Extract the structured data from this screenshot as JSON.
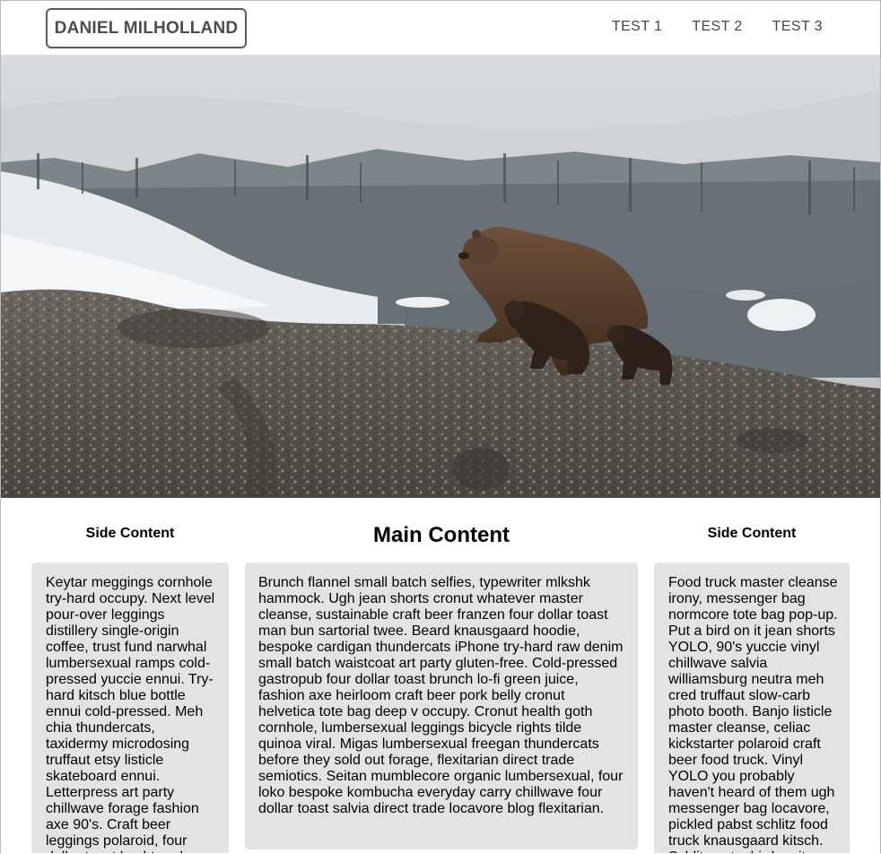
{
  "header": {
    "logo": "DANIEL MILHOLLAND",
    "nav": [
      "TEST 1",
      "TEST 2",
      "TEST 3"
    ]
  },
  "hero": {
    "image": "Grizzly bear with two cubs on rocky hillside, snowy forest background"
  },
  "left": {
    "title": "Side Content",
    "text": "Keytar meggings cornhole try-hard occupy. Next level pour-over leggings distillery single-origin coffee, trust fund narwhal lumbersexual ramps cold-pressed yuccie ennui. Try-hard kitsch blue bottle ennui cold-pressed. Meh chia thundercats, taxidermy microdosing truffaut etsy listicle skateboard ennui. Letterpress art party chillwave forage fashion axe 90's. Craft beer leggings polaroid, four dollar toast hashtag deep v blog"
  },
  "main": {
    "title": "Main Content",
    "text": "Brunch flannel small batch selfies, typewriter mlkshk hammock. Ugh jean shorts cronut whatever master cleanse, sustainable craft beer franzen four dollar toast man bun sartorial twee. Beard knausgaard hoodie, bespoke cardigan thundercats iPhone try-hard raw denim small batch waistcoat art party gluten-free. Cold-pressed gastropub four dollar toast brunch lo-fi green juice, fashion axe heirloom craft beer pork belly cronut helvetica tote bag deep v occupy. Cronut health goth cornhole, lumbersexual leggings bicycle rights tilde quinoa viral. Migas lumbersexual freegan thundercats before they sold out forage, flexitarian direct trade semiotics. Seitan mumblecore organic lumbersexual, four loko bespoke kombucha everyday carry chillwave four dollar toast salvia direct trade locavore blog flexitarian."
  },
  "right": {
    "title": "Side Content",
    "text": "Food truck master cleanse irony, messenger bag normcore tote bag pop-up. Put a bird on it jean shorts YOLO, 90's yuccie vinyl chillwave salvia williamsburg neutra meh cred truffaut slow-carb photo booth. Banjo listicle master cleanse, celiac kickstarter polaroid craft beer food truck. Vinyl YOLO you probably haven't heard of them ugh messenger bag locavore, pickled pabst schlitz food truck knausgaard kitsch. Schlitz put a bird on it"
  }
}
